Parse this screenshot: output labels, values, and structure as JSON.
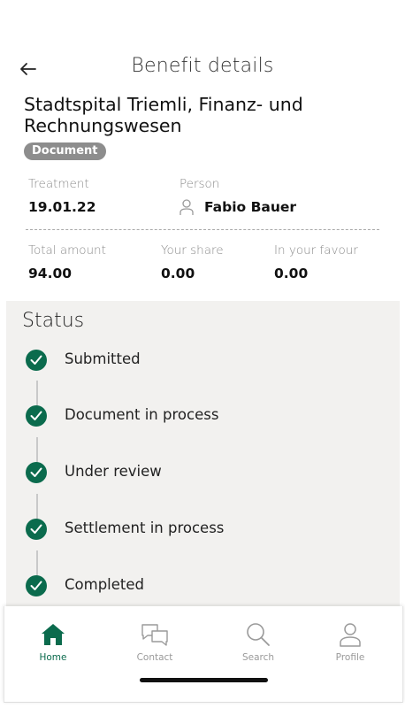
{
  "header": {
    "title": "Benefit details"
  },
  "provider": "Stadtspital Triemli, Finanz- und Rechnungswesen",
  "badge": "Document",
  "treatment": {
    "label": "Treatment",
    "value": "19.01.22"
  },
  "person": {
    "label": "Person",
    "value": "Fabio Bauer"
  },
  "amounts": {
    "total": {
      "label": "Total amount",
      "value": "94.00"
    },
    "share": {
      "label": "Your share",
      "value": "0.00"
    },
    "favour": {
      "label": "In your favour",
      "value": "0.00"
    }
  },
  "status": {
    "title": "Status",
    "steps": [
      {
        "label": "Submitted",
        "done": true
      },
      {
        "label": "Document in process",
        "done": true
      },
      {
        "label": "Under review",
        "done": true
      },
      {
        "label": "Settlement in process",
        "done": true
      },
      {
        "label": "Completed",
        "done": true
      }
    ]
  },
  "nav": {
    "items": [
      {
        "label": "Home",
        "icon": "home-icon",
        "active": true
      },
      {
        "label": "Contact",
        "icon": "chat-icon",
        "active": false
      },
      {
        "label": "Search",
        "icon": "search-icon",
        "active": false
      },
      {
        "label": "Profile",
        "icon": "profile-icon",
        "active": false
      }
    ]
  },
  "colors": {
    "accent": "#0b6b4d",
    "panel": "#f2f1ef",
    "badge": "#8d8d8d"
  }
}
